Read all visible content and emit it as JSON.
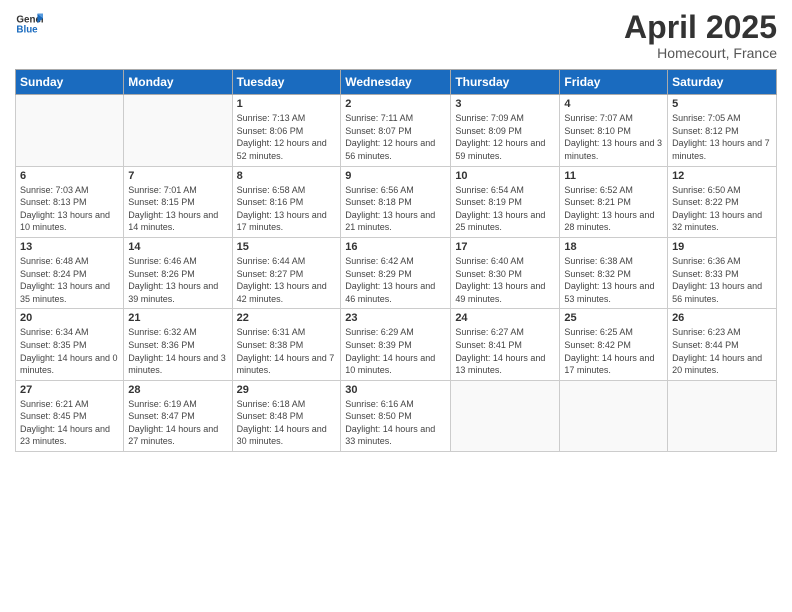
{
  "logo": {
    "text_general": "General",
    "text_blue": "Blue"
  },
  "title": "April 2025",
  "subtitle": "Homecourt, France",
  "days_of_week": [
    "Sunday",
    "Monday",
    "Tuesday",
    "Wednesday",
    "Thursday",
    "Friday",
    "Saturday"
  ],
  "weeks": [
    [
      {
        "num": "",
        "sunrise": "",
        "sunset": "",
        "daylight": ""
      },
      {
        "num": "",
        "sunrise": "",
        "sunset": "",
        "daylight": ""
      },
      {
        "num": "1",
        "sunrise": "Sunrise: 7:13 AM",
        "sunset": "Sunset: 8:06 PM",
        "daylight": "Daylight: 12 hours and 52 minutes."
      },
      {
        "num": "2",
        "sunrise": "Sunrise: 7:11 AM",
        "sunset": "Sunset: 8:07 PM",
        "daylight": "Daylight: 12 hours and 56 minutes."
      },
      {
        "num": "3",
        "sunrise": "Sunrise: 7:09 AM",
        "sunset": "Sunset: 8:09 PM",
        "daylight": "Daylight: 12 hours and 59 minutes."
      },
      {
        "num": "4",
        "sunrise": "Sunrise: 7:07 AM",
        "sunset": "Sunset: 8:10 PM",
        "daylight": "Daylight: 13 hours and 3 minutes."
      },
      {
        "num": "5",
        "sunrise": "Sunrise: 7:05 AM",
        "sunset": "Sunset: 8:12 PM",
        "daylight": "Daylight: 13 hours and 7 minutes."
      }
    ],
    [
      {
        "num": "6",
        "sunrise": "Sunrise: 7:03 AM",
        "sunset": "Sunset: 8:13 PM",
        "daylight": "Daylight: 13 hours and 10 minutes."
      },
      {
        "num": "7",
        "sunrise": "Sunrise: 7:01 AM",
        "sunset": "Sunset: 8:15 PM",
        "daylight": "Daylight: 13 hours and 14 minutes."
      },
      {
        "num": "8",
        "sunrise": "Sunrise: 6:58 AM",
        "sunset": "Sunset: 8:16 PM",
        "daylight": "Daylight: 13 hours and 17 minutes."
      },
      {
        "num": "9",
        "sunrise": "Sunrise: 6:56 AM",
        "sunset": "Sunset: 8:18 PM",
        "daylight": "Daylight: 13 hours and 21 minutes."
      },
      {
        "num": "10",
        "sunrise": "Sunrise: 6:54 AM",
        "sunset": "Sunset: 8:19 PM",
        "daylight": "Daylight: 13 hours and 25 minutes."
      },
      {
        "num": "11",
        "sunrise": "Sunrise: 6:52 AM",
        "sunset": "Sunset: 8:21 PM",
        "daylight": "Daylight: 13 hours and 28 minutes."
      },
      {
        "num": "12",
        "sunrise": "Sunrise: 6:50 AM",
        "sunset": "Sunset: 8:22 PM",
        "daylight": "Daylight: 13 hours and 32 minutes."
      }
    ],
    [
      {
        "num": "13",
        "sunrise": "Sunrise: 6:48 AM",
        "sunset": "Sunset: 8:24 PM",
        "daylight": "Daylight: 13 hours and 35 minutes."
      },
      {
        "num": "14",
        "sunrise": "Sunrise: 6:46 AM",
        "sunset": "Sunset: 8:26 PM",
        "daylight": "Daylight: 13 hours and 39 minutes."
      },
      {
        "num": "15",
        "sunrise": "Sunrise: 6:44 AM",
        "sunset": "Sunset: 8:27 PM",
        "daylight": "Daylight: 13 hours and 42 minutes."
      },
      {
        "num": "16",
        "sunrise": "Sunrise: 6:42 AM",
        "sunset": "Sunset: 8:29 PM",
        "daylight": "Daylight: 13 hours and 46 minutes."
      },
      {
        "num": "17",
        "sunrise": "Sunrise: 6:40 AM",
        "sunset": "Sunset: 8:30 PM",
        "daylight": "Daylight: 13 hours and 49 minutes."
      },
      {
        "num": "18",
        "sunrise": "Sunrise: 6:38 AM",
        "sunset": "Sunset: 8:32 PM",
        "daylight": "Daylight: 13 hours and 53 minutes."
      },
      {
        "num": "19",
        "sunrise": "Sunrise: 6:36 AM",
        "sunset": "Sunset: 8:33 PM",
        "daylight": "Daylight: 13 hours and 56 minutes."
      }
    ],
    [
      {
        "num": "20",
        "sunrise": "Sunrise: 6:34 AM",
        "sunset": "Sunset: 8:35 PM",
        "daylight": "Daylight: 14 hours and 0 minutes."
      },
      {
        "num": "21",
        "sunrise": "Sunrise: 6:32 AM",
        "sunset": "Sunset: 8:36 PM",
        "daylight": "Daylight: 14 hours and 3 minutes."
      },
      {
        "num": "22",
        "sunrise": "Sunrise: 6:31 AM",
        "sunset": "Sunset: 8:38 PM",
        "daylight": "Daylight: 14 hours and 7 minutes."
      },
      {
        "num": "23",
        "sunrise": "Sunrise: 6:29 AM",
        "sunset": "Sunset: 8:39 PM",
        "daylight": "Daylight: 14 hours and 10 minutes."
      },
      {
        "num": "24",
        "sunrise": "Sunrise: 6:27 AM",
        "sunset": "Sunset: 8:41 PM",
        "daylight": "Daylight: 14 hours and 13 minutes."
      },
      {
        "num": "25",
        "sunrise": "Sunrise: 6:25 AM",
        "sunset": "Sunset: 8:42 PM",
        "daylight": "Daylight: 14 hours and 17 minutes."
      },
      {
        "num": "26",
        "sunrise": "Sunrise: 6:23 AM",
        "sunset": "Sunset: 8:44 PM",
        "daylight": "Daylight: 14 hours and 20 minutes."
      }
    ],
    [
      {
        "num": "27",
        "sunrise": "Sunrise: 6:21 AM",
        "sunset": "Sunset: 8:45 PM",
        "daylight": "Daylight: 14 hours and 23 minutes."
      },
      {
        "num": "28",
        "sunrise": "Sunrise: 6:19 AM",
        "sunset": "Sunset: 8:47 PM",
        "daylight": "Daylight: 14 hours and 27 minutes."
      },
      {
        "num": "29",
        "sunrise": "Sunrise: 6:18 AM",
        "sunset": "Sunset: 8:48 PM",
        "daylight": "Daylight: 14 hours and 30 minutes."
      },
      {
        "num": "30",
        "sunrise": "Sunrise: 6:16 AM",
        "sunset": "Sunset: 8:50 PM",
        "daylight": "Daylight: 14 hours and 33 minutes."
      },
      {
        "num": "",
        "sunrise": "",
        "sunset": "",
        "daylight": ""
      },
      {
        "num": "",
        "sunrise": "",
        "sunset": "",
        "daylight": ""
      },
      {
        "num": "",
        "sunrise": "",
        "sunset": "",
        "daylight": ""
      }
    ]
  ]
}
